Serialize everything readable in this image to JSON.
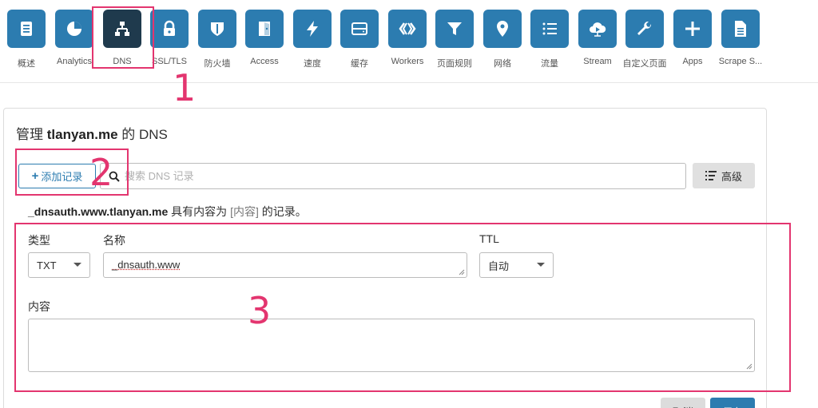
{
  "nav": {
    "items": [
      {
        "label": "概述",
        "icon": "overview-icon"
      },
      {
        "label": "Analytics",
        "icon": "analytics-icon"
      },
      {
        "label": "DNS",
        "icon": "dns-icon",
        "active": true
      },
      {
        "label": "SSL/TLS",
        "icon": "lock-icon"
      },
      {
        "label": "防火墙",
        "icon": "shield-icon"
      },
      {
        "label": "Access",
        "icon": "door-icon"
      },
      {
        "label": "速度",
        "icon": "lightning-icon"
      },
      {
        "label": "缓存",
        "icon": "storage-icon"
      },
      {
        "label": "Workers",
        "icon": "workers-icon"
      },
      {
        "label": "页面规则",
        "icon": "filter-icon"
      },
      {
        "label": "网络",
        "icon": "location-pin-icon"
      },
      {
        "label": "流量",
        "icon": "list-icon"
      },
      {
        "label": "Stream",
        "icon": "cloud-play-icon"
      },
      {
        "label": "自定义页面",
        "icon": "wrench-icon"
      },
      {
        "label": "Apps",
        "icon": "plus-icon"
      },
      {
        "label": "Scrape S...",
        "icon": "document-icon"
      }
    ]
  },
  "annotations": {
    "n1": "1",
    "n2": "2",
    "n3": "3"
  },
  "dns": {
    "title_prefix": "管理 ",
    "title_domain": "tlanyan.me",
    "title_suffix": " 的 DNS",
    "add_button": "添加记录",
    "search_placeholder": "搜索 DNS 记录",
    "advanced_button": "高级",
    "record_name": "_dnsauth.www.tlanyan.me",
    "record_text_mid": " 具有内容为 ",
    "record_content_token": "[内容]",
    "record_text_end": " 的记录。",
    "form": {
      "type_label": "类型",
      "type_value": "TXT",
      "name_label": "名称",
      "name_value": "_dnsauth.www",
      "ttl_label": "TTL",
      "ttl_value": "自动",
      "content_label": "内容",
      "content_value": ""
    },
    "cancel_button": "取消",
    "save_button": "保存"
  },
  "colors": {
    "primary": "#2c7cb0",
    "active_nav": "#1f3a4d",
    "annotation": "#e3356f"
  }
}
